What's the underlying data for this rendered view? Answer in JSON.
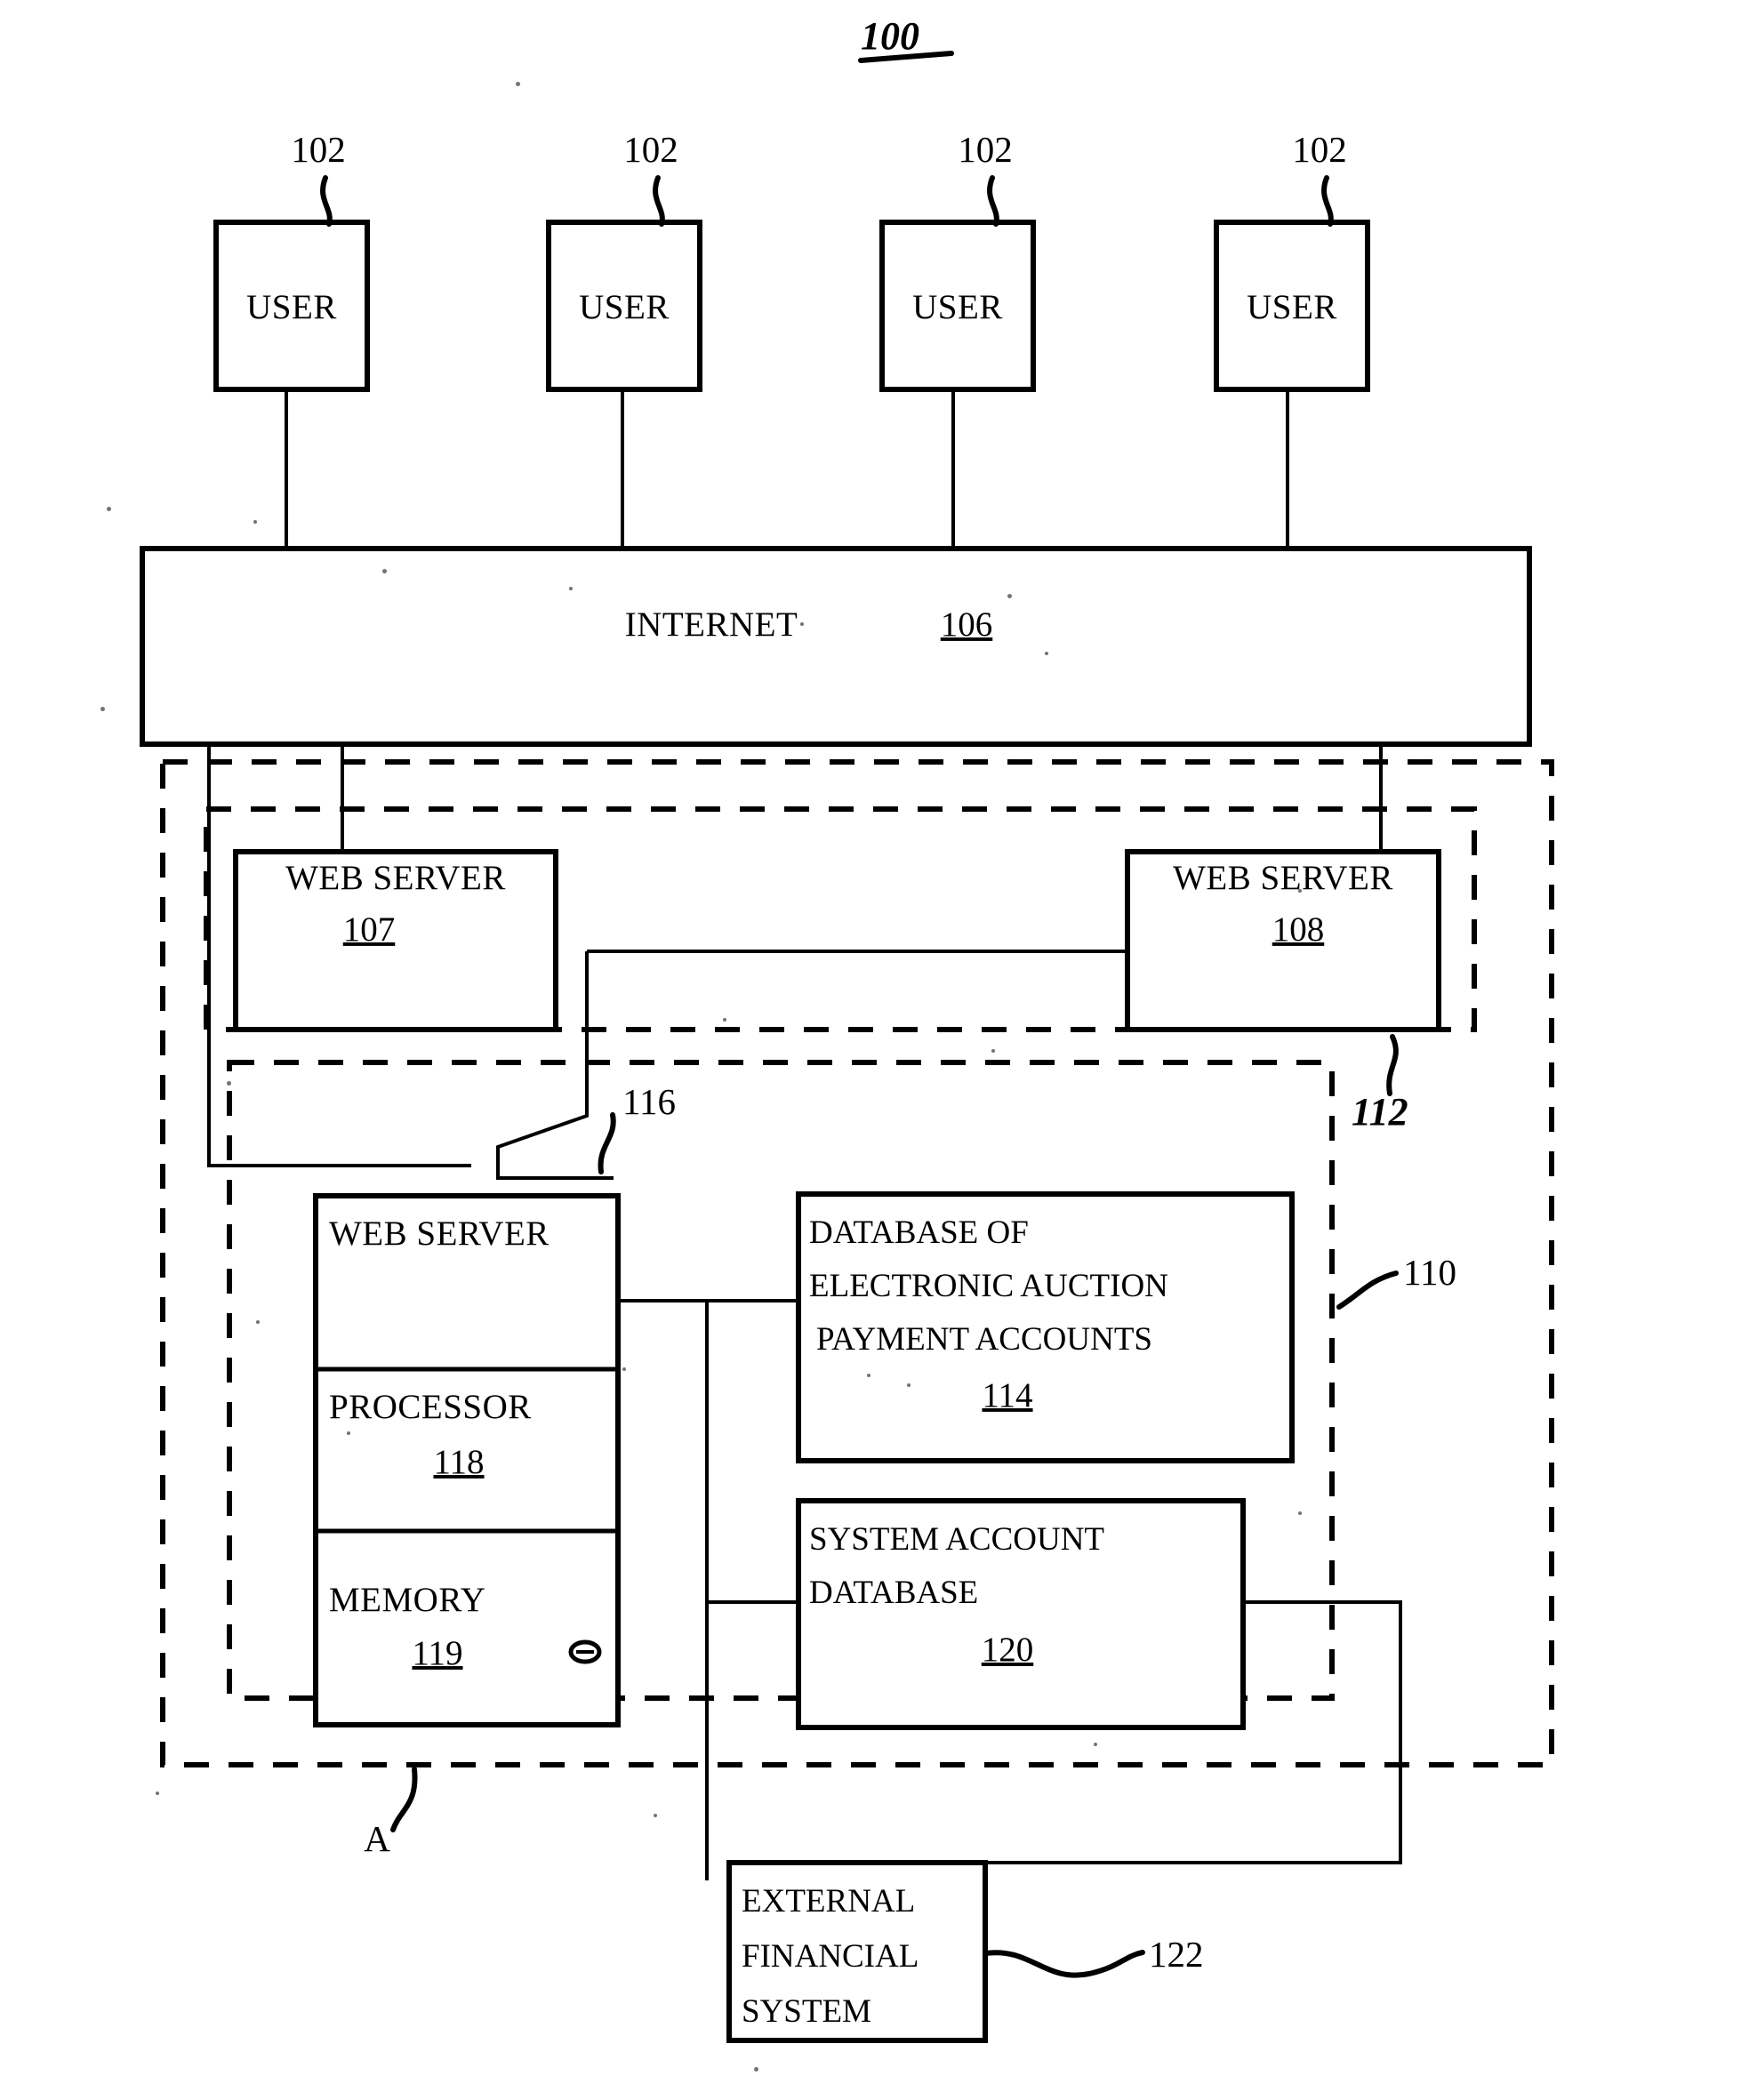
{
  "figure": {
    "number": "100",
    "title_ref": "100"
  },
  "users": [
    {
      "label": "USER",
      "ref": "102"
    },
    {
      "label": "USER",
      "ref": "102"
    },
    {
      "label": "USER",
      "ref": "102"
    },
    {
      "label": "USER",
      "ref": "102"
    }
  ],
  "internet": {
    "label": "INTERNET",
    "ref": "106"
  },
  "web_servers": [
    {
      "label": "WEB SERVER",
      "ref": "107"
    },
    {
      "label": "WEB SERVER",
      "ref": "108"
    }
  ],
  "core_server": {
    "web_server_label": "WEB SERVER",
    "web_server_ref": "116",
    "processor_label": "PROCESSOR",
    "processor_ref": "118",
    "memory_label": "MEMORY",
    "memory_ref": "119"
  },
  "databases": [
    {
      "line1": "DATABASE OF",
      "line2": "ELECTRONIC AUCTION",
      "line3": "PAYMENT ACCOUNTS",
      "ref": "114"
    },
    {
      "line1": "SYSTEM ACCOUNT",
      "line2": "DATABASE",
      "line3": "",
      "ref": "120"
    }
  ],
  "external": {
    "line1": "EXTERNAL",
    "line2": "FINANCIAL",
    "line3": "SYSTEM",
    "ref": "122"
  },
  "boundaries": [
    {
      "name": "outer-system",
      "ref": "A"
    },
    {
      "name": "front-end-group",
      "ref": "112"
    },
    {
      "name": "back-end-group",
      "ref": "110"
    }
  ],
  "colors": {
    "ink": "#000000",
    "paper": "#ffffff"
  }
}
